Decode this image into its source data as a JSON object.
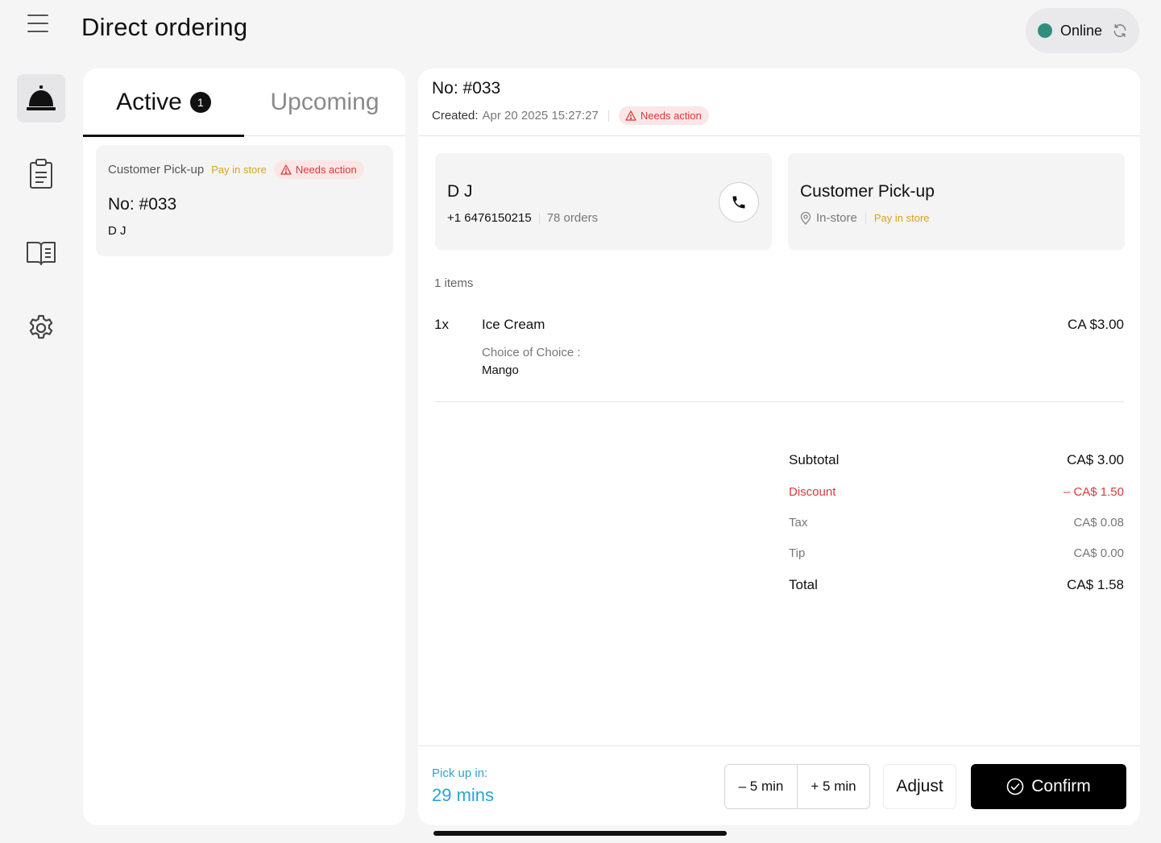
{
  "header": {
    "title": "Direct ordering",
    "status": {
      "label": "Online",
      "color": "#2f8f7c"
    }
  },
  "sidebar": {
    "items": [
      {
        "icon": "service-bell-icon",
        "active": true
      },
      {
        "icon": "clipboard-icon",
        "active": false
      },
      {
        "icon": "menu-book-icon",
        "active": false
      },
      {
        "icon": "gear-icon",
        "active": false
      }
    ]
  },
  "tabs": {
    "active": {
      "label": "Active",
      "count": "1"
    },
    "upcoming": {
      "label": "Upcoming"
    }
  },
  "order_list": [
    {
      "type": "Customer Pick-up",
      "payment": "Pay in store",
      "badge": "Needs action",
      "number": "No: #033",
      "customer": "D J"
    }
  ],
  "order_detail": {
    "number": "No: #033",
    "created_label": "Created:",
    "created_value": "Apr 20 2025 15:27:27",
    "badge": "Needs action",
    "customer": {
      "name": "D J",
      "phone": "+1 6476150215",
      "orders": "78 orders"
    },
    "fulfillment": {
      "type": "Customer Pick-up",
      "location": "In-store",
      "payment": "Pay in store"
    },
    "items_count": "1 items",
    "items": [
      {
        "qty": "1x",
        "name": "Ice Cream",
        "price": "CA $3.00",
        "option_label": "Choice of Choice :",
        "option_value": "Mango"
      }
    ],
    "totals": {
      "subtotal": {
        "label": "Subtotal",
        "value": "CA$ 3.00"
      },
      "discount": {
        "label": "Discount",
        "value": "– CA$ 1.50"
      },
      "tax": {
        "label": "Tax",
        "value": "CA$ 0.08"
      },
      "tip": {
        "label": "Tip",
        "value": "CA$ 0.00"
      },
      "total": {
        "label": "Total",
        "value": "CA$ 1.58"
      }
    }
  },
  "footer": {
    "pickup_label": "Pick up in:",
    "pickup_value": "29 mins",
    "minus_label": "– 5 min",
    "plus_label": "+ 5 min",
    "adjust_label": "Adjust",
    "confirm_label": "Confirm"
  },
  "colors": {
    "accent_blue": "#2aa3d6",
    "warning_red": "#d93a3a",
    "pay_yellow": "#d8a21e",
    "online_green": "#2f8f7c"
  }
}
